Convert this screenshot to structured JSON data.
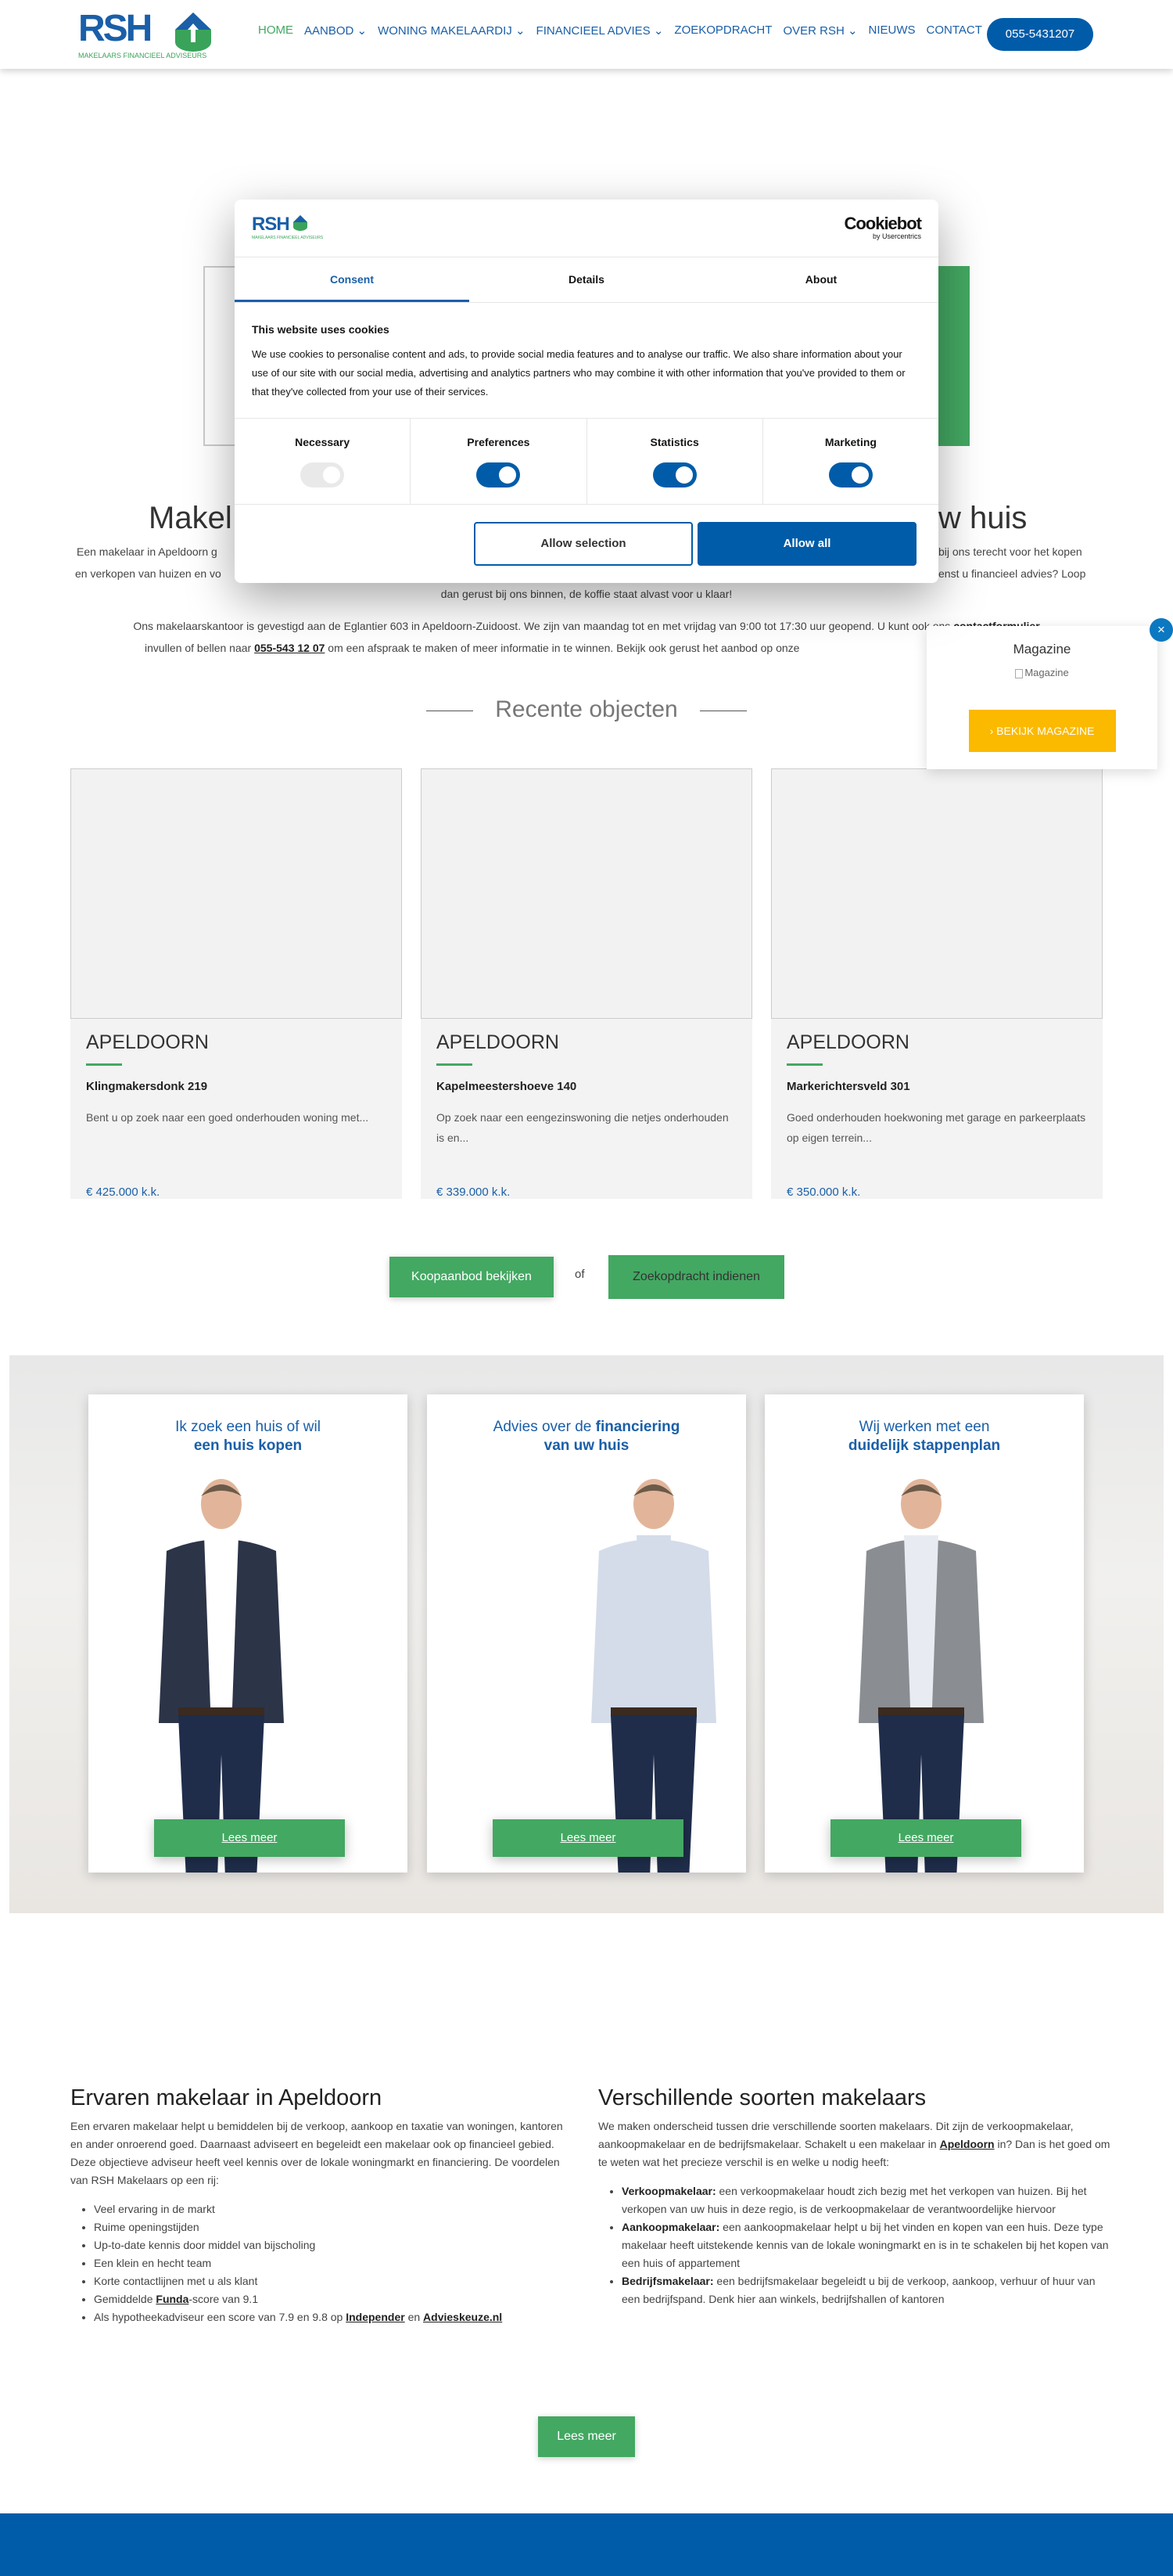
{
  "header": {
    "logo_text": "RSH",
    "logo_sub": "MAKELAARS FINANCIEEL ADVISEURS",
    "nav": [
      {
        "label": "HOME",
        "active": true
      },
      {
        "label": "AANBOD ⌄"
      },
      {
        "label": "WONING MAKELAARDIJ ⌄"
      },
      {
        "label": "FINANCIEEL ADVIES ⌄"
      },
      {
        "label": "ZOEKOPDRACHT"
      },
      {
        "label": "OVER RSH ⌄"
      },
      {
        "label": "NIEUWS"
      },
      {
        "label": "CONTACT"
      }
    ],
    "phone": "055-5431207"
  },
  "hero": {
    "title_left": "Makel",
    "title_right": "w huis",
    "line1_left": "Een makelaar in Apeldoorn g",
    "line1_right": "bij ons terecht voor het kopen",
    "line2_left": "en verkopen van huizen en vo",
    "line2_right": "enst u financieel advies? Loop",
    "line3": "dan gerust bij ons binnen, de koffie staat alvast voor u klaar!",
    "p2_line1_a": "Ons makelaarskantoor is gevestigd aan de Eglantier 603 in Apeldoorn-Zuidoost. We zijn van maandag tot en met vrijdag van 9:00 tot 17:30 uur geopend. U kunt ook ons ",
    "p2_line1_link": "contactformulier",
    "p2_line2_a": "invullen of bellen naar ",
    "p2_line2_link": "055-543 12 07",
    "p2_line2_b": " om een afspraak te maken of meer informatie in te winnen. Bekijk ook gerust het aanbod op onze"
  },
  "recent": {
    "title": "Recente objecten",
    "items": [
      {
        "city": "APELDOORN",
        "street": "Klingmakersdonk 219",
        "desc": "Bent u op zoek naar een goed onderhouden woning met...",
        "price": "€ 425.000 k.k."
      },
      {
        "city": "APELDOORN",
        "street": "Kapelmeestershoeve 140",
        "desc": "Op zoek naar een eengezinswoning die netjes onderhouden is en...",
        "price": "€ 339.000 k.k."
      },
      {
        "city": "APELDOORN",
        "street": "Markerichtersveld 301",
        "desc": "Goed onderhouden hoekwoning met garage en parkeerplaats op eigen terrein...",
        "price": "€ 350.000 k.k."
      }
    ],
    "btn_koop": "Koopaanbod bekijken",
    "or": "of",
    "btn_zoek": "Zoekopdracht indienen"
  },
  "team": [
    {
      "t1": "Ik zoek een huis of wil",
      "t2": "een huis kopen",
      "t2_bold": "",
      "btn": "Lees meer",
      "jacket": "#2c3448",
      "shirt": "#ffffff"
    },
    {
      "t1": "Advies over de ",
      "t1_bold": "financiering",
      "t2": "van uw huis",
      "btn": "Lees meer",
      "jacket": "",
      "shirt": "#d4dcea"
    },
    {
      "t1": "Wij werken met een",
      "t2": "duidelijk stappenplan",
      "btn": "Lees meer",
      "jacket": "#8a8d92",
      "shirt": "#e8ecf2"
    }
  ],
  "info": {
    "left": {
      "title": "Ervaren makelaar in Apeldoorn",
      "text": "Een ervaren makelaar helpt u bemiddelen bij de verkoop, aankoop en taxatie van woningen, kantoren en ander onroerend goed. Daarnaast adviseert en begeleidt een makelaar ook op financieel gebied. Deze objectieve adviseur heeft veel kennis over de lokale woningmarkt en financiering. De voordelen van RSH Makelaars op een rij:",
      "items": [
        "Veel ervaring in de markt",
        "Ruime openingstijden",
        "Up-to-date kennis door middel van bijscholing",
        "Een klein en hecht team",
        "Korte contactlijnen met u als klant"
      ],
      "funda_a": "Gemiddelde ",
      "funda_link": "Funda",
      "funda_b": "-score van 9.1",
      "score_a": "Als hypotheekadviseur een score van 7.9 en 9.8 op ",
      "score_link1": "Independer",
      "score_mid": " en ",
      "score_link2": "Advieskeuze.nl"
    },
    "right": {
      "title": "Verschillende soorten makelaars",
      "text_a": "We maken onderscheid tussen drie verschillende soorten makelaars. Dit zijn de verkoopmakelaar, aankoopmakelaar en de bedrijfsmakelaar. Schakelt u een makelaar in ",
      "text_link": "Apeldoorn",
      "text_b": " in? Dan is het goed om te weten wat het precieze verschil is en welke u nodig heeft:",
      "items": [
        {
          "term": "Verkoopmakelaar:",
          "desc": " een verkoopmakelaar houdt zich bezig met het verkopen van huizen. Bij het verkopen van uw huis in deze regio, is de verkoopmakelaar de verantwoordelijke hiervoor"
        },
        {
          "term": "Aankoopmakelaar:",
          "desc": " een aankoopmakelaar helpt u bij het vinden en kopen van een huis. Deze type makelaar heeft uitstekende kennis van de lokale woningmarkt en is in te schakelen bij het kopen van een huis of appartement"
        },
        {
          "term": "Bedrijfsmakelaar:",
          "desc": " een bedrijfsmakelaar begeleidt u bij de verkoop, aankoop, verhuur of huur van een bedrijfspand. Denk hier aan winkels, bedrijfshallen of kantoren"
        }
      ]
    },
    "btn": "Lees meer"
  },
  "magazine": {
    "title": "Magazine",
    "img_alt": "Magazine",
    "btn": "BEKIJK MAGAZINE",
    "close": "×"
  },
  "cookie": {
    "brand": "Cookiebot",
    "brand_sub": "by Usercentrics",
    "logo_text": "RSH",
    "logo_sub": "MAKELAARS FINANCIEEL ADVISEURS",
    "tabs": [
      {
        "label": "Consent",
        "active": true
      },
      {
        "label": "Details"
      },
      {
        "label": "About"
      }
    ],
    "heading": "This website uses cookies",
    "text": "We use cookies to personalise content and ads, to provide social media features and to analyse our traffic. We also share information about your use of our site with our social media, advertising and analytics partners who may combine it with other information that you've provided to them or that they've collected from your use of their services.",
    "categories": [
      {
        "label": "Necessary",
        "on": true,
        "disabled": true
      },
      {
        "label": "Preferences",
        "on": true
      },
      {
        "label": "Statistics",
        "on": true
      },
      {
        "label": "Marketing",
        "on": true
      }
    ],
    "allow_selection": "Allow selection",
    "allow_all": "Allow all"
  },
  "colors": {
    "brand_blue": "#005ca9",
    "green": "#43a862",
    "yellow": "#fbb900"
  }
}
